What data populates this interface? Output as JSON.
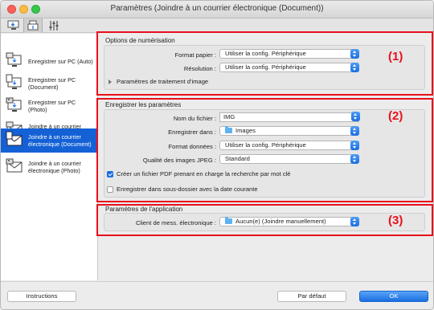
{
  "window": {
    "title": "Paramètres (Joindre à un courrier électronique (Document))"
  },
  "toolbar": {
    "tabs": [
      {
        "icon": "scan-to-pc-icon"
      },
      {
        "icon": "scan-from-panel-icon"
      },
      {
        "icon": "general-settings-icon"
      }
    ]
  },
  "sidebar": {
    "items": [
      {
        "label": "Enregistrer sur PC (Auto)",
        "icon": "save-to-pc-auto-icon"
      },
      {
        "label": "Enregistrer sur PC\n(Document)",
        "icon": "save-to-pc-document-icon"
      },
      {
        "label": "Enregistrer sur PC\n(Photo)",
        "icon": "save-to-pc-photo-icon"
      },
      {
        "label": "Joindre à un courrier\nélectronique (Auto)",
        "icon": "attach-email-auto-icon"
      },
      {
        "label": "Joindre à un courrier\nélectronique (Document)",
        "icon": "attach-email-document-icon"
      },
      {
        "label": "Joindre à un courrier\nélectronique (Photo)",
        "icon": "attach-email-photo-icon"
      }
    ],
    "selected_index": 4
  },
  "scan_options": {
    "title": "Options de numérisation",
    "number": "(1)",
    "paper_size_label": "Format papier :",
    "paper_size_value": "Utiliser la config. Périphérique",
    "resolution_label": "Résolution :",
    "resolution_value": "Utiliser la config. Périphérique",
    "image_processing_label": "Paramètres de traitement d'image"
  },
  "save_settings": {
    "title": "Enregistrer les paramètres",
    "number": "(2)",
    "file_name_label": "Nom du fichier :",
    "file_name_value": "IMG",
    "save_in_label": "Enregistrer dans :",
    "save_in_value": "Images",
    "data_format_label": "Format données :",
    "data_format_value": "Utiliser la config. Périphérique",
    "jpeg_quality_label": "Qualité des images JPEG :",
    "jpeg_quality_value": "Standard",
    "searchable_pdf_label": "Créer un fichier PDF prenant en charge la recherche par mot clé",
    "searchable_pdf_checked": true,
    "subfolder_label": "Enregistrer dans sous-dossier avec la date courante",
    "subfolder_checked": false
  },
  "app_settings": {
    "title": "Paramètres de l'application",
    "number": "(3)",
    "email_client_label": "Client de mess. électronique :",
    "email_client_value": "Aucun(e) (Joindre manuellement)"
  },
  "footer": {
    "instructions_label": "Instructions",
    "defaults_label": "Par défaut",
    "ok_label": "OK"
  },
  "colors": {
    "accent": "#1a6ee0",
    "highlight": "#e8101c",
    "selected_row": "#1461d6"
  }
}
